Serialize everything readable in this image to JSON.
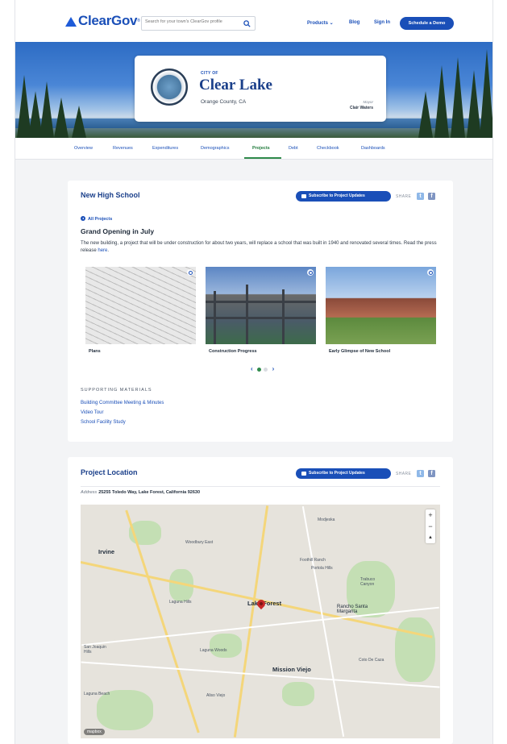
{
  "brand": {
    "name": "ClearGov",
    "tm": "®",
    "accent": "#1a4fb8"
  },
  "nav": {
    "search_placeholder": "Search for your town's ClearGov profile",
    "products": "Products ⌄",
    "blog": "Blog",
    "sign_in": "Sign In",
    "demo": "Schedule a Demo"
  },
  "city": {
    "city_of": "CITY OF",
    "name": "Clear Lake",
    "county": "Orange County, CA",
    "mayor_label": "Mayor",
    "mayor_name": "Clair Waters"
  },
  "tabs": [
    {
      "label": "Overview"
    },
    {
      "label": "Revenues"
    },
    {
      "label": "Expenditures"
    },
    {
      "label": "Demographics"
    },
    {
      "label": "Projects"
    },
    {
      "label": "Debt"
    },
    {
      "label": "Checkbook"
    },
    {
      "label": "Dashboards"
    }
  ],
  "project": {
    "title": "New High School",
    "subscribe": "Subscribe to Project Updates",
    "share": "SHARE",
    "all_projects": "All Projects",
    "headline": "Grand Opening in July",
    "description": "The new building, a project that will be under construction for about two years, will replace a school that was built in 1940 and renovated several times. Read the press release ",
    "description_link": "here",
    "description_end": ".",
    "gallery": [
      {
        "caption": "Plans"
      },
      {
        "caption": "Construction Progress"
      },
      {
        "caption": "Early Glimpse of New School"
      }
    ],
    "supporting_heading": "SUPPORTING MATERIALS",
    "supporting": [
      {
        "label": "Building Committee Meeting & Minutes"
      },
      {
        "label": "Video Tour"
      },
      {
        "label": "School Facility Study"
      }
    ]
  },
  "location": {
    "title": "Project Location",
    "subscribe": "Subscribe to Project Updates",
    "share": "SHARE",
    "address_label": "Address",
    "address": "25255 Toledo Way, Lake Forest, California 92630",
    "map_labels": {
      "irvine": "Irvine",
      "lake_forest": "Lake Forest",
      "rancho": "Rancho Santa Margarita",
      "mission_viejo": "Mission Viejo",
      "laguna_woods": "Laguna Woods",
      "aliso_viejo": "Aliso Viejo",
      "foothill": "Foothill Ranch",
      "portola": "Portola Hills",
      "trabuco": "Trabuco Canyon",
      "coto": "Coto De Caza",
      "laguna_hills": "Laguna Hills",
      "san_joaquin": "San Joaquin Hills",
      "modjeska": "Modjeska",
      "woodbury": "Woodbury East",
      "laguna_beach": "Laguna Beach"
    },
    "zoom_in": "+",
    "zoom_out": "−",
    "north": "▲",
    "map_brand": "mapbox"
  }
}
